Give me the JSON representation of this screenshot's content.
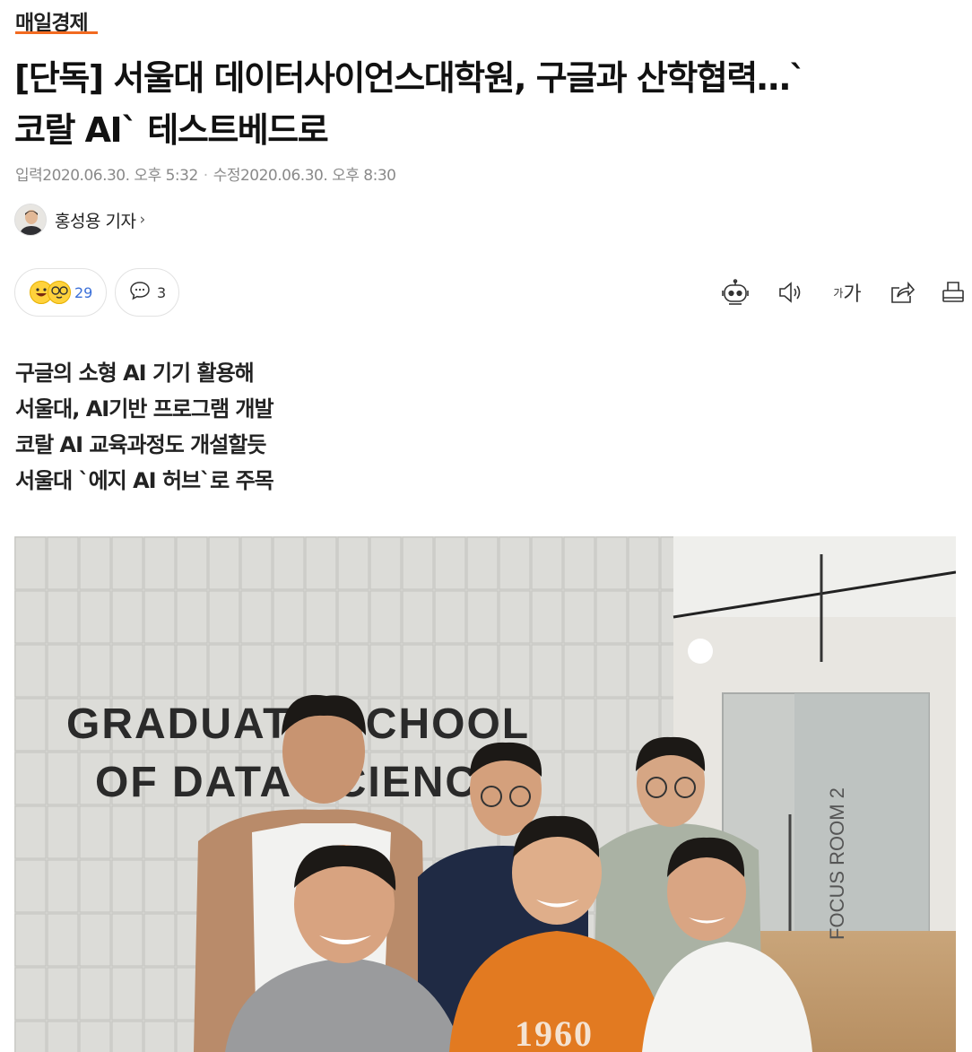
{
  "publisher": {
    "name": "매일경제"
  },
  "article": {
    "headline_line1": "[단독] 서울대 데이터사이언스대학원, 구글과 산학협력…`",
    "headline_line2": "코랄 AI` 테스트베드로",
    "published_label": "입력",
    "published_date": "2020.06.30. 오후 5:32",
    "modified_label": "수정",
    "modified_date": "2020.06.30. 오후 8:30",
    "author": "홍성용 기자",
    "summary": [
      "구글의 소형 AI 기기 활용해",
      "서울대, AI기반 프로그램 개발",
      "코랄 AI 교육과정도 개설할듯",
      "서울대 `에지 AI 허브`로 주목"
    ]
  },
  "reactions": {
    "count": "29",
    "icons": [
      "smile-emoji-icon",
      "glasses-emoji-icon"
    ]
  },
  "comments": {
    "count": "3",
    "icon": "comment-bubble-icon"
  },
  "toolbar": {
    "icons": [
      "robot-summary-icon",
      "speaker-icon",
      "font-size-icon",
      "share-icon",
      "print-icon"
    ],
    "font_size_label_small": "가",
    "font_size_label_large": "가"
  },
  "photo": {
    "sign_line1": "GRADUATE SCHOOL",
    "sign_line2": "OF DATA SCIENCE",
    "door_text": "FOCUS ROOM 2",
    "shirt_text": "1960"
  },
  "colors": {
    "accent": "#f26a20",
    "reaction_count": "#3a6fd8",
    "meta_gray": "#8a8a8a"
  }
}
